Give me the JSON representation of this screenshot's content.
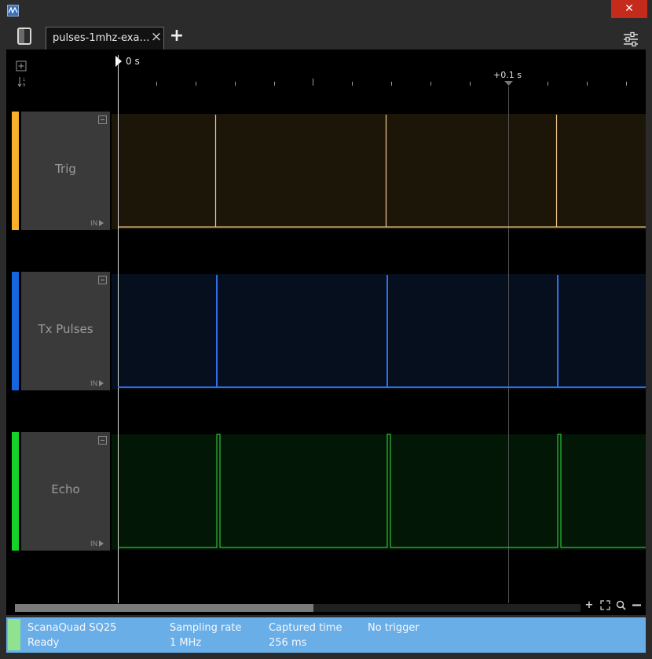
{
  "window": {
    "close_label": "✕"
  },
  "tabs": [
    {
      "label": "pulses-1mhz-exact..."
    }
  ],
  "toolbar": {
    "add_tab_label": "+"
  },
  "ruler": {
    "start_label": "0 s",
    "marker_label": "+0.1 s"
  },
  "channels": [
    {
      "name": "Trig",
      "io_label": "IN",
      "color": "#f7b12a",
      "bg": "#1c1609",
      "line": "#f3c98a"
    },
    {
      "name": "Tx Pulses",
      "io_label": "IN",
      "color": "#1565e0",
      "bg": "#050f1e",
      "line": "#2f6fe3"
    },
    {
      "name": "Echo",
      "io_label": "IN",
      "color": "#14d22a",
      "bg": "#021706",
      "line": "#2fbf36"
    }
  ],
  "status": {
    "device": "ScanaQuad SQ25",
    "device_state": "Ready",
    "sampling_rate_label": "Sampling rate",
    "sampling_rate_value": "1 MHz",
    "captured_time_label": "Captured time",
    "captured_time_value": "256 ms",
    "trigger_label": "No trigger"
  },
  "icons": [
    "app-icon",
    "sidebar-toggle-icon",
    "close-icon",
    "add-icon",
    "settings-sliders-icon",
    "expand-all-icon",
    "sort-icon",
    "zoom-in-icon",
    "fit-icon",
    "search-icon",
    "zoom-out-icon"
  ]
}
